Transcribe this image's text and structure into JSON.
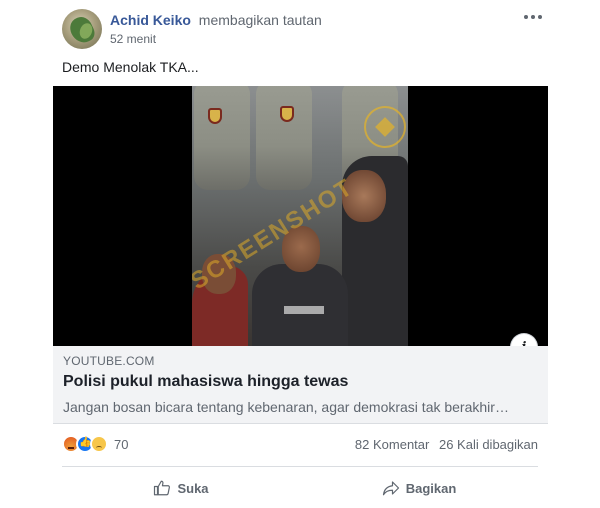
{
  "header": {
    "author": "Achid Keiko",
    "action": "membagikan tautan",
    "time": "52 menit"
  },
  "post": {
    "text": "Demo Menolak TKA..."
  },
  "link": {
    "domain": "YOUTUBE.COM",
    "title": "Polisi pukul mahasiswa hingga tewas",
    "description": "Jangan bosan bicara tentang kebenaran, agar demokrasi tak berakhir…",
    "info_icon": "info-icon",
    "watermark": "SCREENSHOT"
  },
  "engagement": {
    "reaction_icons": [
      "angry-icon",
      "like-icon",
      "sad-icon"
    ],
    "reaction_count": "70",
    "comments": "82 Komentar",
    "shares": "26 Kali dibagikan"
  },
  "actions": {
    "like_label": "Suka",
    "share_label": "Bagikan"
  },
  "colors": {
    "author": "#385898",
    "secondary_text": "#606770",
    "like_blue": "#1877f2",
    "link_bg": "#f2f3f5"
  }
}
